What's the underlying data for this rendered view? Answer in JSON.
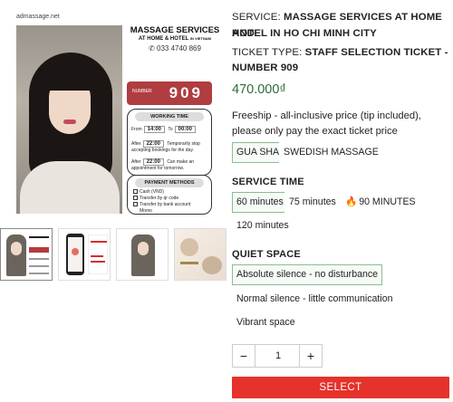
{
  "gallery": {
    "site": "admassage.net",
    "poster_title": "MASSAGE SERVICES",
    "poster_sub": "AT HOME & HOTEL",
    "poster_sub2": "IN VIETNAM",
    "poster_phone": "033 4740 869",
    "number_label": "NUMBER",
    "number_value": "909",
    "working_time": {
      "heading": "WORKING TIME",
      "from_label": "From",
      "from_value": "14:00",
      "to_label": "To",
      "to_value": "00:00",
      "after1_label": "After",
      "after1_value": "22:00",
      "after1_text": "Temporarily stop accepting bookings for the day.",
      "after2_label": "After",
      "after2_value": "22:00",
      "after2_text": "Can make an appointment for tomorrow."
    },
    "payment": {
      "heading": "PAYMENT METHODS",
      "items": [
        "Cash (VND)",
        "Transfer by qr code",
        "Transfer by bank account",
        "Momo"
      ]
    }
  },
  "product": {
    "service_label": "SERVICE:",
    "service_value_line1": "MASSAGE SERVICES AT HOME AND",
    "service_value_line2": "HOTEL IN HO CHI MINH CITY",
    "ticket_label": "TICKET TYPE:",
    "ticket_value_line1": "STAFF SELECTION TICKET -",
    "ticket_value_line2": "NUMBER 909",
    "price": "470.000₫",
    "note": "Freeship - all-inclusive price (tip included), please only pay the exact ticket price",
    "type_options": [
      "GUA SHA",
      "SWEDISH MASSAGE"
    ],
    "service_time_title": "SERVICE TIME",
    "time_options": [
      "60 minutes",
      "75 minutes",
      "90 MINUTES",
      "120 minutes"
    ],
    "fire_icon": "🔥",
    "quiet_title": "QUIET SPACE",
    "quiet_options": [
      "Absolute silence - no disturbance",
      "Normal silence - little communication",
      "Vibrant space"
    ],
    "quantity": "1",
    "minus": "−",
    "plus": "+",
    "select_label": "SELECT"
  },
  "colors": {
    "accent_red": "#e5322a",
    "price_green": "#2f6b3a",
    "selected_border": "#8bbd92"
  }
}
